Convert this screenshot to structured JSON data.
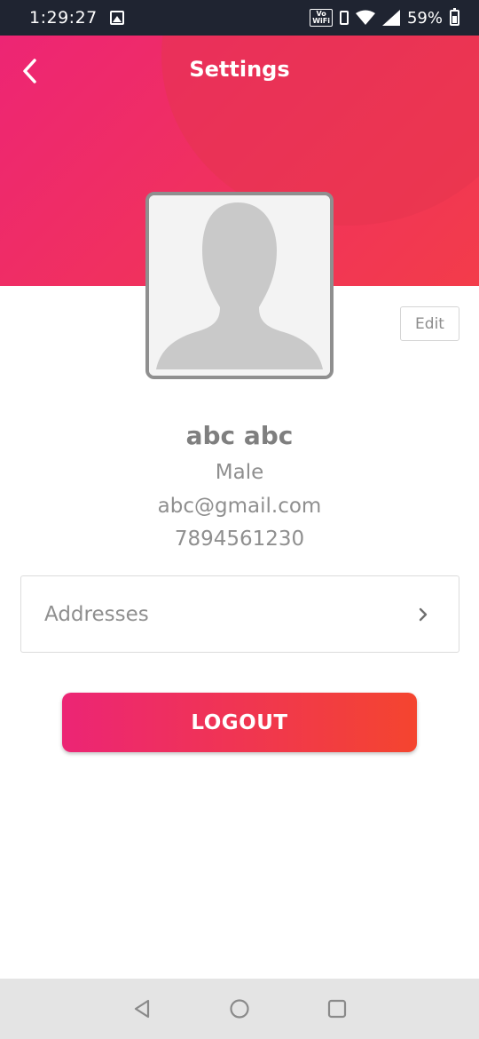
{
  "status_bar": {
    "time": "1:29:27",
    "vowifi_top": "Vo",
    "vowifi_bottom": "WiFi",
    "battery": "59%",
    "icons": [
      "gallery-icon",
      "vowifi-icon",
      "vibrate-icon",
      "wifi-icon",
      "signal-icon",
      "battery-icon"
    ]
  },
  "header": {
    "title": "Settings",
    "back_icon": "chevron-left-icon"
  },
  "profile": {
    "edit_label": "Edit",
    "name": "abc abc",
    "gender": "Male",
    "email": "abc@gmail.com",
    "phone": "7894561230"
  },
  "addresses": {
    "label": "Addresses",
    "icon": "chevron-right-icon"
  },
  "logout_label": "LOGOUT",
  "colors": {
    "header_gradient_start": "#ed2574",
    "header_gradient_end": "#f33c4a",
    "button_gradient_start": "#ec2575",
    "button_gradient_end": "#f4452f",
    "status_bar": "#1f2431",
    "nav_bar": "#e4e4e4"
  },
  "nav_bar": {
    "icons": [
      "back-triangle-icon",
      "home-circle-icon",
      "recents-square-icon"
    ]
  }
}
